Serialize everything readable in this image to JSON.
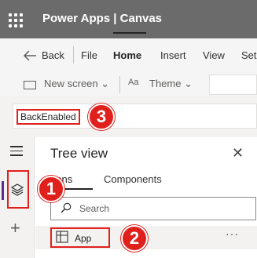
{
  "header": {
    "title": "Power Apps  |  Canvas",
    "waffle_icon": "waffle-icon"
  },
  "menu": {
    "back_label": "Back",
    "items": [
      "File",
      "Home",
      "Insert",
      "View",
      "Set"
    ],
    "active": "Home"
  },
  "toolbar": {
    "new_screen_label": "New screen",
    "theme_label": "Theme"
  },
  "formula": {
    "value": "BackEnabled"
  },
  "callouts": {
    "one": "1",
    "two": "2",
    "three": "3",
    "color": "#e0201c"
  },
  "tree_view": {
    "title": "Tree view",
    "tabs": [
      {
        "label": "eens"
      },
      {
        "label": "Components"
      }
    ],
    "search_placeholder": "Search",
    "node_label": "App",
    "more_label": "···"
  },
  "colors": {
    "header_bg": "#6b6b6b",
    "accent": "#5c2d91",
    "highlight": "#e0201c"
  }
}
